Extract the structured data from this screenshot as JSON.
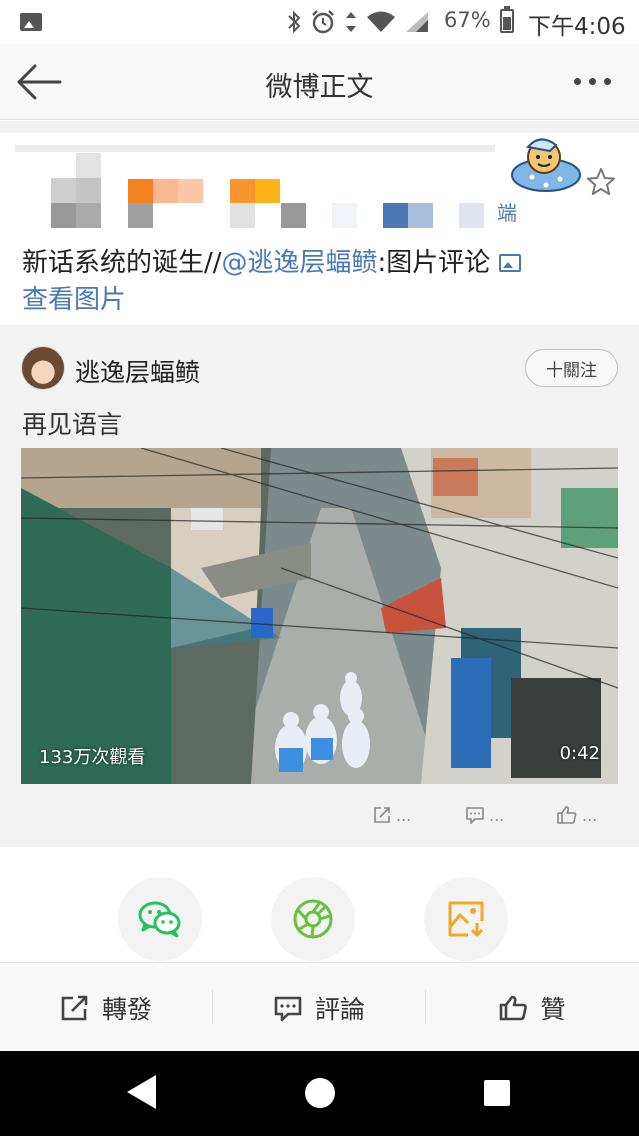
{
  "status_bar": {
    "battery": "67%",
    "time": "下午4:06",
    "icons": [
      "image-icon",
      "bluetooth-icon",
      "alarm-icon",
      "data-arrows-icon",
      "wifi-icon",
      "signal-icon",
      "battery-icon"
    ]
  },
  "nav": {
    "title": "微博正文",
    "back_icon": "arrow-left-icon",
    "more_icon": "more-dots-icon"
  },
  "post": {
    "source_suffix": "端",
    "text_prefix": "新话系统的诞生//",
    "mention": "@逃逸层蝠鲼",
    "text_suffix": ":图片评论",
    "view_image_link": "查看图片"
  },
  "repost": {
    "author": "逃逸层蝠鲼",
    "follow_label": "十關注",
    "text": "再见语言",
    "video": {
      "views": "133万次觀看",
      "duration": "0:42"
    },
    "actions": {
      "repost": "...",
      "comment": "...",
      "like": "..."
    }
  },
  "share": {
    "items": [
      {
        "name": "wechat-share-button",
        "icon": "wechat-icon",
        "color": "#22c35e"
      },
      {
        "name": "moments-share-button",
        "icon": "moments-aperture-icon",
        "color": "#67c23a"
      },
      {
        "name": "save-image-button",
        "icon": "save-image-icon",
        "color": "#f5a623"
      }
    ]
  },
  "bottom_bar": {
    "repost": "轉發",
    "comment": "評論",
    "like": "贊"
  },
  "colors": {
    "link": "#4a79b5",
    "background_gray": "#f2f2f2"
  }
}
